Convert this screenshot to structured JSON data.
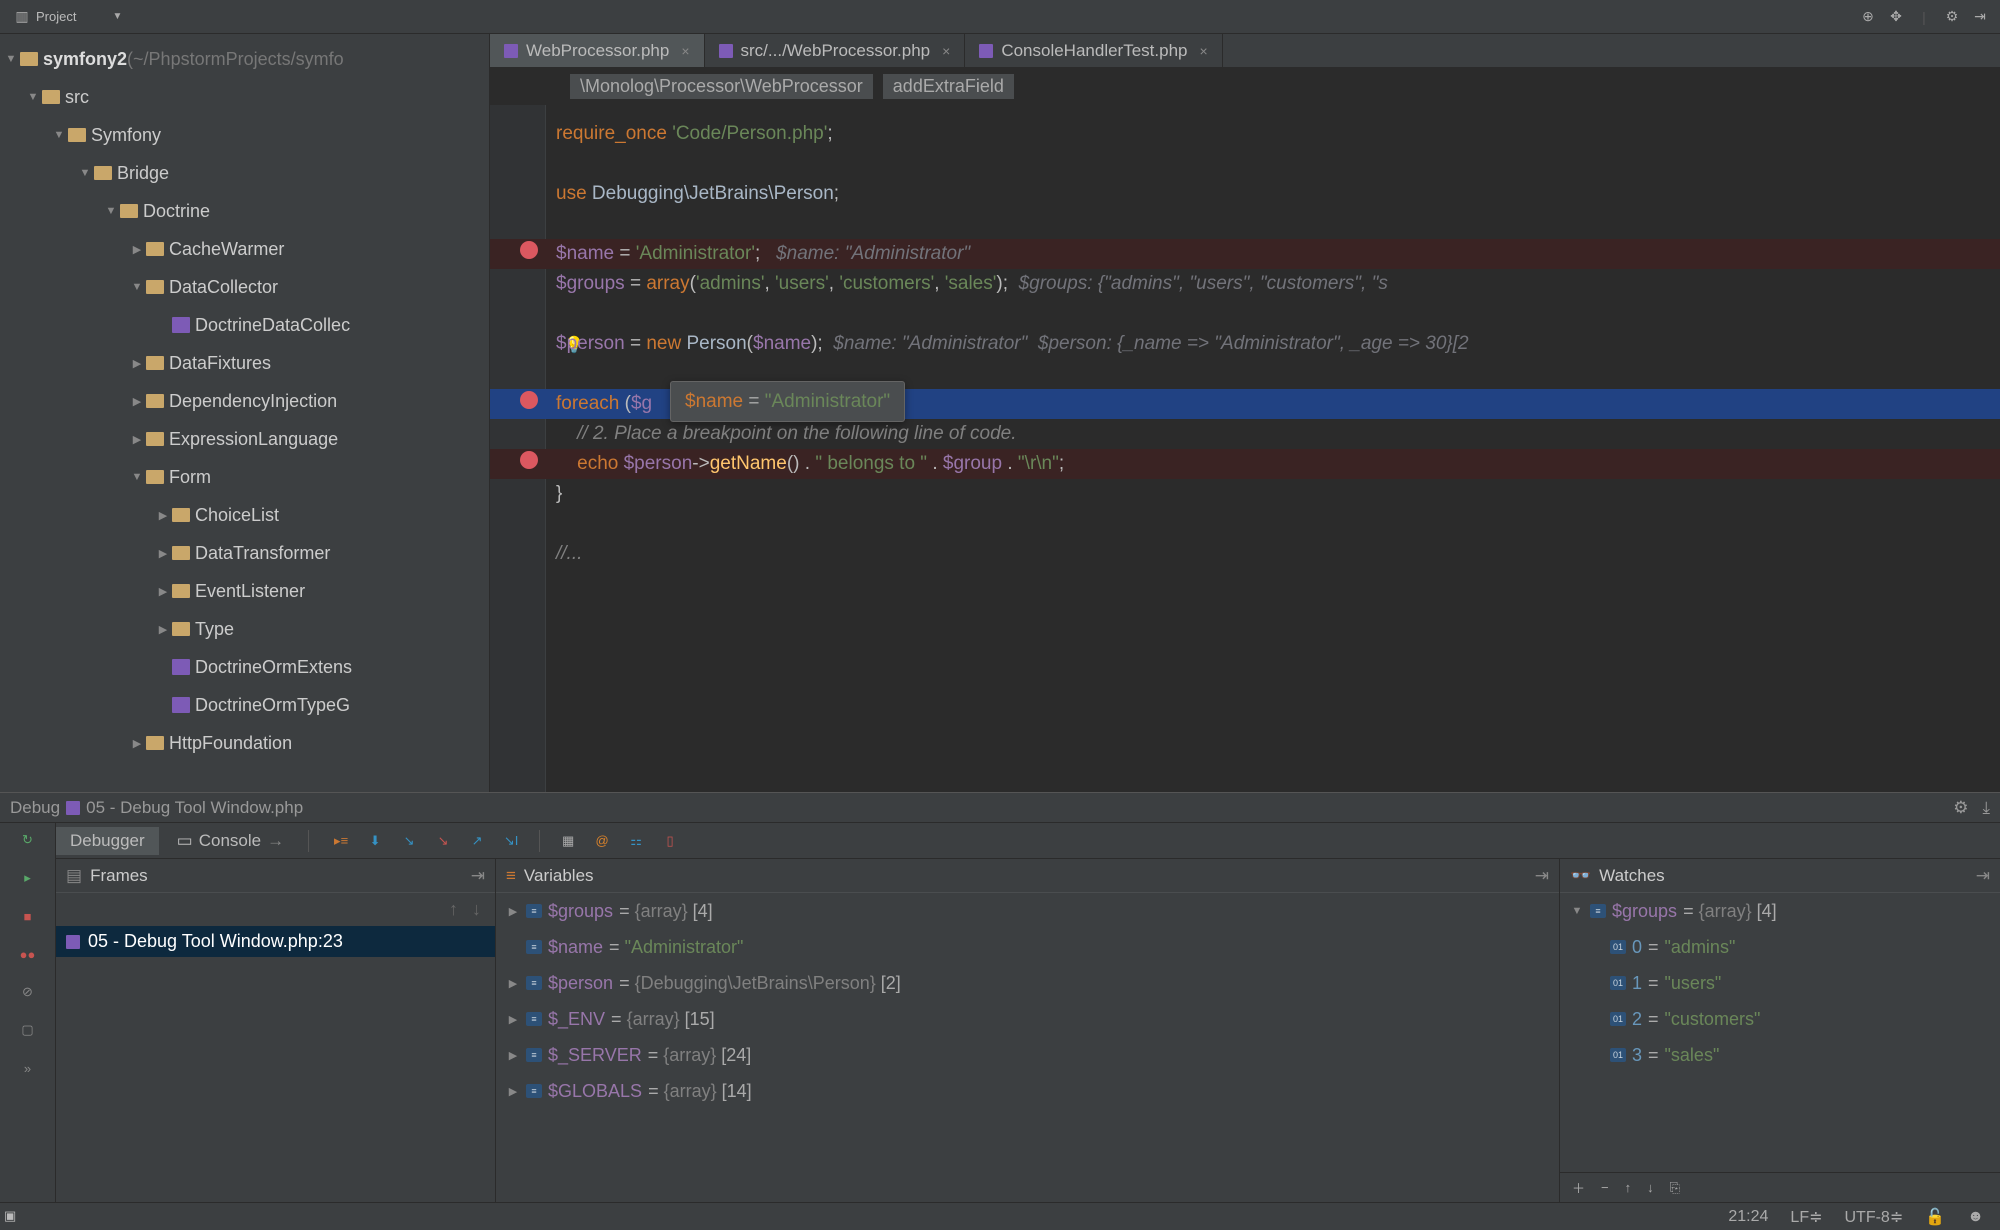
{
  "top": {
    "project_label": "Project"
  },
  "tree": [
    {
      "indent": 0,
      "arrow": "▼",
      "icon": "folder",
      "label": "symfony2",
      "extra": " (~/PhpstormProjects/symfo",
      "bold": true
    },
    {
      "indent": 1,
      "arrow": "▼",
      "icon": "folder",
      "label": "src"
    },
    {
      "indent": 2,
      "arrow": "▼",
      "icon": "folder",
      "label": "Symfony"
    },
    {
      "indent": 3,
      "arrow": "▼",
      "icon": "folder",
      "label": "Bridge"
    },
    {
      "indent": 4,
      "arrow": "▼",
      "icon": "folder",
      "label": "Doctrine"
    },
    {
      "indent": 5,
      "arrow": "▶",
      "icon": "folder",
      "label": "CacheWarmer"
    },
    {
      "indent": 5,
      "arrow": "▼",
      "icon": "folder",
      "label": "DataCollector"
    },
    {
      "indent": 6,
      "arrow": "",
      "icon": "php",
      "label": "DoctrineDataCollec"
    },
    {
      "indent": 5,
      "arrow": "▶",
      "icon": "folder",
      "label": "DataFixtures"
    },
    {
      "indent": 5,
      "arrow": "▶",
      "icon": "folder",
      "label": "DependencyInjection"
    },
    {
      "indent": 5,
      "arrow": "▶",
      "icon": "folder",
      "label": "ExpressionLanguage"
    },
    {
      "indent": 5,
      "arrow": "▼",
      "icon": "folder",
      "label": "Form"
    },
    {
      "indent": 6,
      "arrow": "▶",
      "icon": "folder",
      "label": "ChoiceList"
    },
    {
      "indent": 6,
      "arrow": "▶",
      "icon": "folder",
      "label": "DataTransformer"
    },
    {
      "indent": 6,
      "arrow": "▶",
      "icon": "folder",
      "label": "EventListener"
    },
    {
      "indent": 6,
      "arrow": "▶",
      "icon": "folder",
      "label": "Type"
    },
    {
      "indent": 6,
      "arrow": "",
      "icon": "php",
      "label": "DoctrineOrmExtens"
    },
    {
      "indent": 6,
      "arrow": "",
      "icon": "php",
      "label": "DoctrineOrmTypeG"
    },
    {
      "indent": 5,
      "arrow": "▶",
      "icon": "folder",
      "label": "HttpFoundation"
    }
  ],
  "tabs": [
    {
      "label": "WebProcessor.php",
      "active": true
    },
    {
      "label": "src/.../WebProcessor.php",
      "active": false
    },
    {
      "label": "ConsoleHandlerTest.php",
      "active": false
    }
  ],
  "breadcrumb": [
    "\\Monolog\\Processor\\WebProcessor",
    "addExtraField"
  ],
  "tooltip": {
    "var": "$name",
    "val": "\"Administrator\""
  },
  "debug": {
    "title_prefix": "Debug",
    "title_file": "05 - Debug Tool Window.php",
    "tabs": {
      "debugger": "Debugger",
      "console": "Console"
    },
    "frames": {
      "title": "Frames",
      "row": "05 - Debug Tool Window.php:23"
    },
    "variables": {
      "title": "Variables",
      "items": [
        {
          "arrow": "▶",
          "name": "$groups",
          "rest": " = {array} [4]"
        },
        {
          "arrow": "",
          "name": "$name",
          "rest": " = \"Administrator\"",
          "str": true
        },
        {
          "arrow": "▶",
          "name": "$person",
          "rest": " = {Debugging\\JetBrains\\Person} [2]"
        },
        {
          "arrow": "▶",
          "name": "$_ENV",
          "rest": " = {array} [15]"
        },
        {
          "arrow": "▶",
          "name": "$_SERVER",
          "rest": " = {array} [24]"
        },
        {
          "arrow": "▶",
          "name": "$GLOBALS",
          "rest": " = {array} [14]"
        }
      ]
    },
    "watches": {
      "title": "Watches",
      "root": {
        "name": "$groups",
        "rest": " = {array} [4]"
      },
      "items": [
        {
          "key": "0",
          "val": "\"admins\""
        },
        {
          "key": "1",
          "val": "\"users\""
        },
        {
          "key": "2",
          "val": "\"customers\""
        },
        {
          "key": "3",
          "val": "\"sales\""
        }
      ]
    }
  },
  "status": {
    "pos": "21:24",
    "le": "LF≑",
    "enc": "UTF-8≑",
    "lock": "🔓"
  }
}
